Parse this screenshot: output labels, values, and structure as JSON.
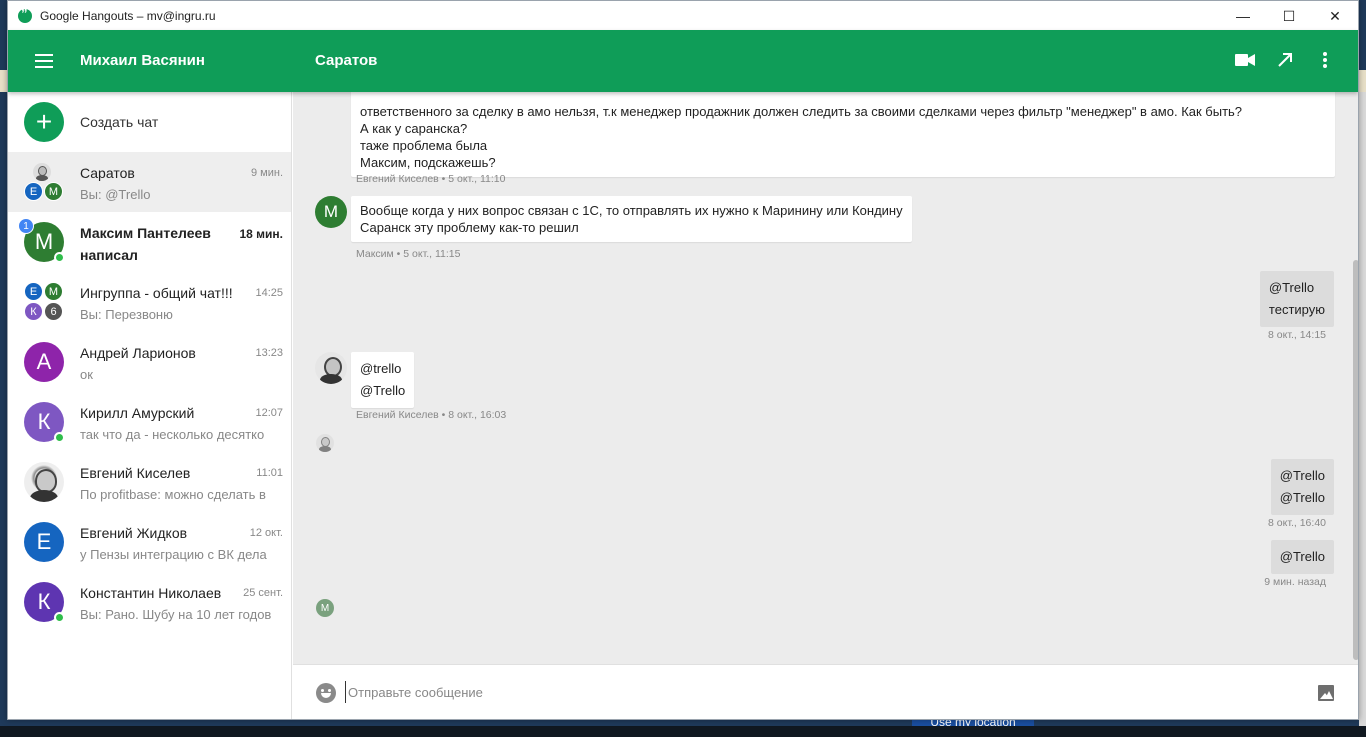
{
  "window": {
    "title": "Google Hangouts – mv@ingru.ru",
    "controls": {
      "minimize": "—",
      "maximize": "☐",
      "close": "✕"
    }
  },
  "header": {
    "user_name": "Михаил Васянин",
    "conversation_title": "Саратов",
    "icons": [
      "video-call-icon",
      "popout-icon",
      "more-vert-icon"
    ]
  },
  "sidebar": {
    "new_chat_label": "Создать чат",
    "conversations": [
      {
        "name": "Саратов",
        "time": "9 мин.",
        "preview": "Вы: @Trello",
        "mini_avatars": [
          {
            "letter": "Е",
            "color": "#1565c0"
          },
          {
            "letter": "М",
            "color": "#2e7d32"
          }
        ]
      },
      {
        "name": "Максим Пантелеев написал",
        "time": "18 мин.",
        "preview": "",
        "avatar_letter": "М",
        "avatar_color": "#2e7d32",
        "unread_count": "1"
      },
      {
        "name": "Ингруппа - общий чат!!!",
        "time": "14:25",
        "preview": "Вы: Перезвоню",
        "mini_avatars": [
          {
            "letter": "Е",
            "color": "#1565c0"
          },
          {
            "letter": "М",
            "color": "#2e7d32"
          },
          {
            "letter": "К",
            "color": "#7e57c2"
          },
          {
            "letter": "6",
            "color": "#555555"
          }
        ]
      },
      {
        "name": "Андрей Ларионов",
        "time": "13:23",
        "preview": "ок",
        "avatar_letter": "А",
        "avatar_color": "#8e24aa"
      },
      {
        "name": "Кирилл Амурский",
        "time": "12:07",
        "preview": "так что да - несколько десятко",
        "avatar_letter": "К",
        "avatar_color": "#7e57c2"
      },
      {
        "name": "Евгений Киселев",
        "time": "11:01",
        "preview": "По profitbase: можно сделать в"
      },
      {
        "name": "Евгений Жидков",
        "time": "12 окт.",
        "preview": "у Пензы интеграцию с ВК дела",
        "avatar_letter": "Е",
        "avatar_color": "#1565c0"
      },
      {
        "name": "Константин Николаев",
        "time": "25 сент.",
        "preview": "Вы: Рано. Шубу на 10 лет годов",
        "avatar_letter": "К",
        "avatar_color": "#5e35b1"
      }
    ]
  },
  "chat": {
    "messages": [
      {
        "lines": [
          "ответственного за сделку в амо нельзя, т.к менеджер продажник должен следить за своими сделками через фильтр \"менеджер\" в амо. Как быть?",
          "А как у саранска?",
          "таже проблема была",
          "Максим, подскажешь?"
        ],
        "meta": "Евгений Киселев • 5 окт., 11:10"
      },
      {
        "lines": [
          "Вообще когда у них вопрос связан с 1С, то отправлять их нужно к Маринину или Кондину",
          "Саранск эту проблему как-то решил"
        ],
        "meta": "Максим • 5 окт., 11:15",
        "avatar_letter": "М"
      },
      {
        "lines": [
          "@Trello",
          "тестирую"
        ],
        "meta": "8 окт., 14:15"
      },
      {
        "lines": [
          "@trello",
          "@Trello"
        ],
        "meta": "Евгений Киселев • 8 окт., 16:03"
      },
      {
        "lines": [
          "@Trello",
          "@Trello"
        ],
        "meta": "8 окт., 16:40"
      },
      {
        "lines": [
          "@Trello"
        ],
        "meta": "9 мин. назад"
      }
    ],
    "read_receipt_letter": "М"
  },
  "composer": {
    "placeholder": "Отправьте сообщение"
  },
  "background": {
    "location_button": "Use my location"
  },
  "colors": {
    "brand_green": "#0f9d58",
    "online": "#2fbd4a",
    "unread": "#4285f4"
  }
}
